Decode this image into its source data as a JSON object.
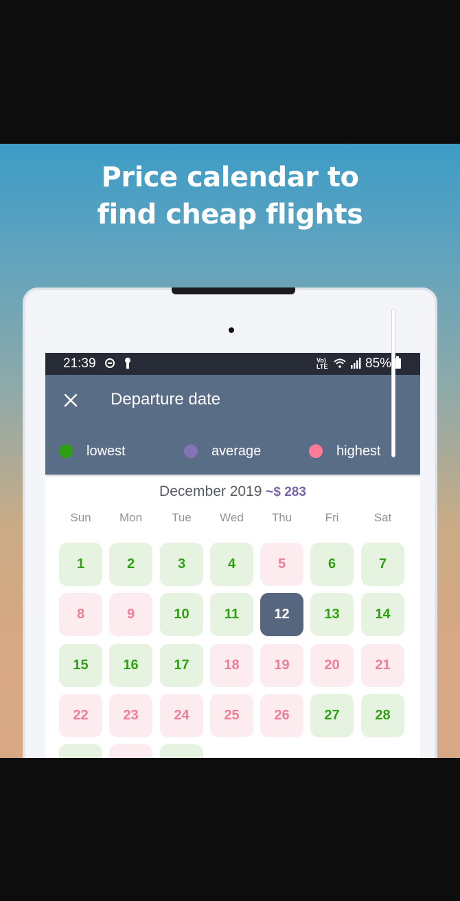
{
  "headline": {
    "line1": "Price calendar to",
    "line2": "find cheap flights"
  },
  "status_bar": {
    "time": "21:39",
    "volte_top": "Vo)",
    "volte_bottom": "LTE",
    "battery": "85%",
    "icons": [
      "do-not-disturb-icon",
      "key-icon",
      "volte-icon",
      "wifi-icon",
      "signal-icon",
      "battery-icon"
    ]
  },
  "app_bar": {
    "title": "Departure date",
    "close_icon": "close-icon"
  },
  "legend": [
    {
      "label": "lowest",
      "color": "#2fa011"
    },
    {
      "label": "average",
      "color": "#8474b6"
    },
    {
      "label": "highest",
      "color": "#ff7b96"
    }
  ],
  "calendar": {
    "month": "December 2019",
    "price": "~$ 283",
    "weekdays": [
      "Sun",
      "Mon",
      "Tue",
      "Wed",
      "Thu",
      "Fri",
      "Sat"
    ],
    "selected_day": "12",
    "days": [
      {
        "label": "1",
        "tier": "low"
      },
      {
        "label": "2",
        "tier": "low"
      },
      {
        "label": "3",
        "tier": "low"
      },
      {
        "label": "4",
        "tier": "low"
      },
      {
        "label": "5",
        "tier": "high"
      },
      {
        "label": "6",
        "tier": "low"
      },
      {
        "label": "7",
        "tier": "low"
      },
      {
        "label": "8",
        "tier": "high"
      },
      {
        "label": "9",
        "tier": "high"
      },
      {
        "label": "10",
        "tier": "low"
      },
      {
        "label": "11",
        "tier": "low"
      },
      {
        "label": "12",
        "tier": "selected"
      },
      {
        "label": "13",
        "tier": "low"
      },
      {
        "label": "14",
        "tier": "low"
      },
      {
        "label": "15",
        "tier": "low"
      },
      {
        "label": "16",
        "tier": "low"
      },
      {
        "label": "17",
        "tier": "low"
      },
      {
        "label": "18",
        "tier": "high"
      },
      {
        "label": "19",
        "tier": "high"
      },
      {
        "label": "20",
        "tier": "high"
      },
      {
        "label": "21",
        "tier": "high"
      },
      {
        "label": "22",
        "tier": "high"
      },
      {
        "label": "23",
        "tier": "high"
      },
      {
        "label": "24",
        "tier": "high"
      },
      {
        "label": "25",
        "tier": "high"
      },
      {
        "label": "26",
        "tier": "high"
      },
      {
        "label": "27",
        "tier": "low"
      },
      {
        "label": "28",
        "tier": "low"
      },
      {
        "label": "",
        "tier": "low"
      },
      {
        "label": "",
        "tier": "high"
      },
      {
        "label": "",
        "tier": "low"
      }
    ]
  },
  "colors": {
    "app_bar": "#5a6d86",
    "status_bar": "#262b36",
    "low_bg": "#e6f3e1",
    "low_text": "#2fa011",
    "high_bg": "#fdecef",
    "high_text": "#ef7d96",
    "selected_bg": "#56667f"
  }
}
